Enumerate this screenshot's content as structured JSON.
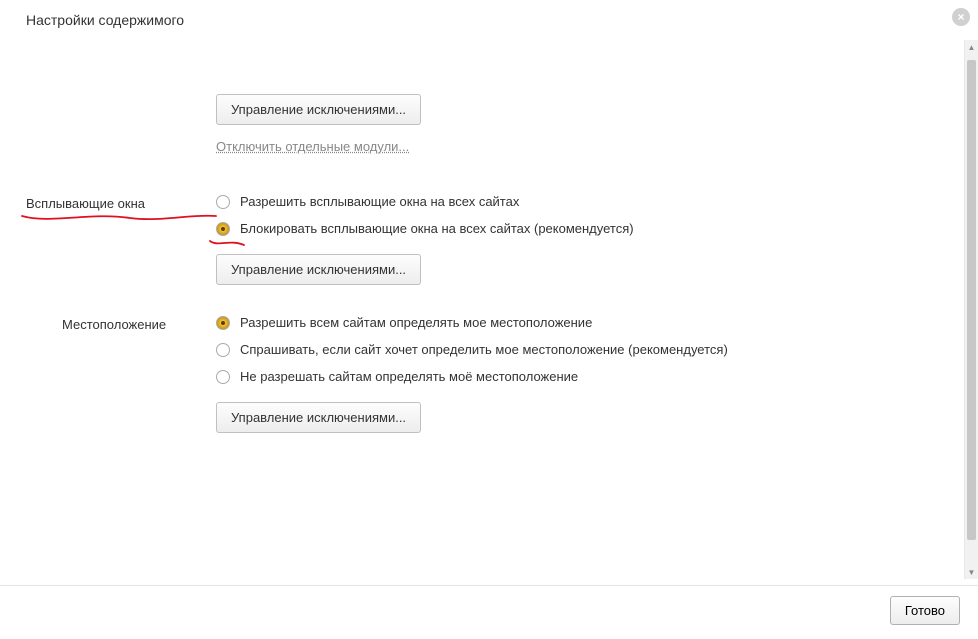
{
  "dialog": {
    "title": "Настройки содержимого",
    "close_icon": "×"
  },
  "section_prev": {
    "button": "Управление исключениями...",
    "link": "Отключить отдельные модули..."
  },
  "popups": {
    "label": "Всплывающие окна",
    "opt_allow": "Разрешить всплывающие окна на всех сайтах",
    "opt_block": "Блокировать всплывающие окна на всех сайтах (рекомендуется)",
    "button": "Управление исключениями..."
  },
  "location": {
    "label": "Местоположение",
    "opt_allow": "Разрешить всем сайтам определять мое местоположение",
    "opt_ask": "Спрашивать, если сайт хочет определить мое местоположение (рекомендуется)",
    "opt_deny": "Не разрешать сайтам определять моё местоположение",
    "button": "Управление исключениями..."
  },
  "footer": {
    "done": "Готово"
  }
}
